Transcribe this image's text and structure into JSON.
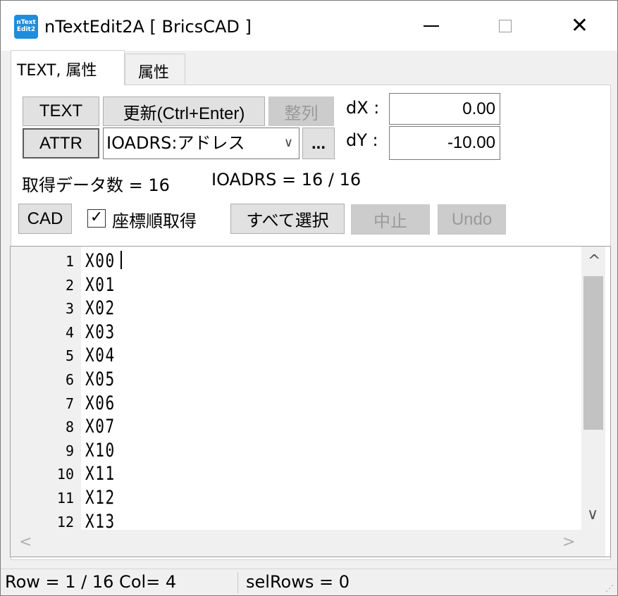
{
  "window": {
    "title": "nTextEdit2A [ BricsCAD ]",
    "icon_text": "nText Edit2",
    "minimize_icon": "minimize-icon",
    "maximize_icon": "maximize-icon",
    "close_glyph": "✕"
  },
  "tabs": [
    {
      "label": "TEXT, 属性",
      "active": true
    },
    {
      "label": "属性",
      "active": false
    }
  ],
  "toolbar": {
    "text_button": "TEXT",
    "update_button": "更新(Ctrl+Enter)",
    "align_button": "整列",
    "attr_button": "ATTR",
    "attr_select": "IOADRS:アドレス",
    "attr_select_arrow": "∨",
    "more_button": "...",
    "dx_label": "dX :",
    "dx_value": "0.00",
    "dy_label": "dY :",
    "dy_value": "-10.00"
  },
  "info": {
    "data_count": "取得データ数 = 16",
    "ioadrs_count": "IOADRS = 16 / 16"
  },
  "actions": {
    "cad_button": "CAD",
    "checkbox_mark": "✓",
    "checkbox_label": "座標順取得",
    "checkbox_checked": true,
    "select_all_button": "すべて選択",
    "stop_button": "中止",
    "undo_button": "Undo"
  },
  "editor": {
    "lines": [
      {
        "num": "1",
        "text": "X00"
      },
      {
        "num": "2",
        "text": "X01"
      },
      {
        "num": "3",
        "text": "X02"
      },
      {
        "num": "4",
        "text": "X03"
      },
      {
        "num": "5",
        "text": "X04"
      },
      {
        "num": "6",
        "text": "X05"
      },
      {
        "num": "7",
        "text": "X06"
      },
      {
        "num": "8",
        "text": "X07"
      },
      {
        "num": "9",
        "text": "X10"
      },
      {
        "num": "10",
        "text": "X11"
      },
      {
        "num": "11",
        "text": "X12"
      },
      {
        "num": "12",
        "text": "X13"
      }
    ],
    "scroll_up": "^",
    "scroll_down": "∨",
    "scroll_left": "<",
    "scroll_right": ">"
  },
  "status": {
    "position": "Row = 1 / 16 Col= 4",
    "selection": "selRows = 0",
    "grip": "⋰"
  }
}
